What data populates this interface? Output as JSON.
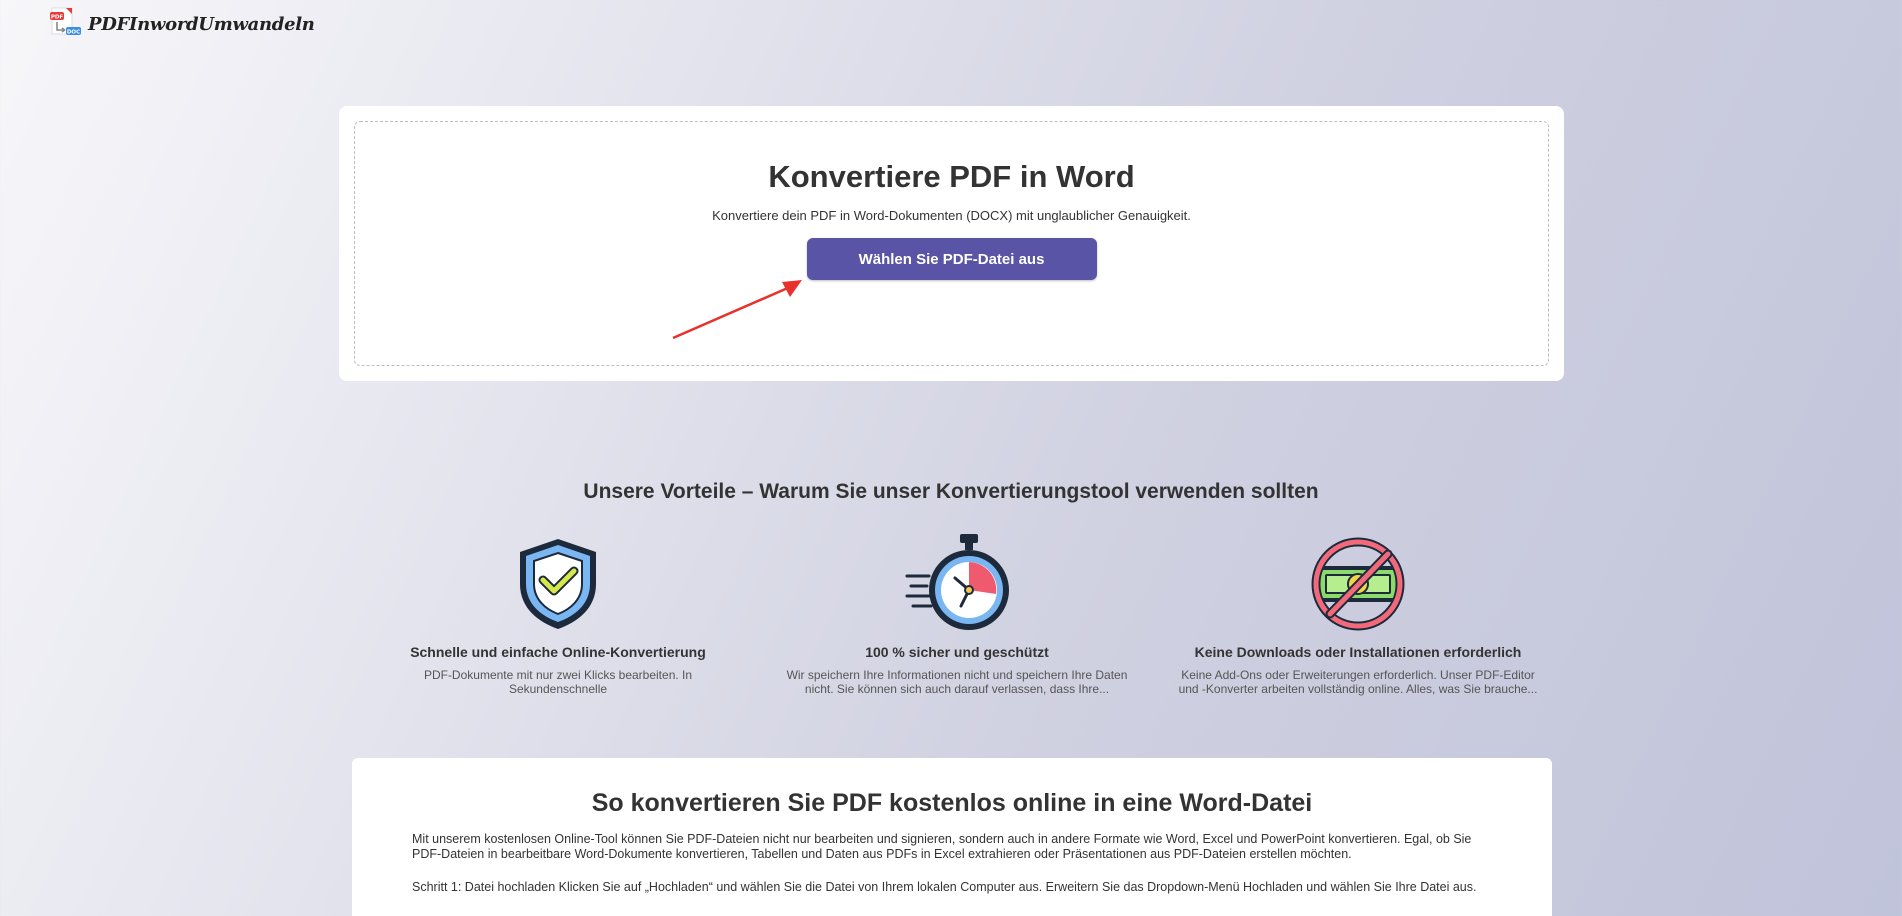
{
  "header": {
    "logo_text": "PDFInwordUmwandeln",
    "logo_badge_top": "PDF",
    "logo_badge_bottom": "DOC"
  },
  "upload": {
    "title": "Konvertiere PDF in Word",
    "subtitle": "Konvertiere dein PDF in Word-Dokumenten (DOCX) mit unglaublicher Genauigkeit.",
    "button_label": "Wählen Sie PDF-Datei aus"
  },
  "benefits": {
    "title": "Unsere Vorteile – Warum Sie unser Konvertierungstool verwenden sollten",
    "items": [
      {
        "icon": "shield-check-icon",
        "title": "Schnelle und einfache Online-Konvertierung",
        "text": "PDF-Dokumente mit nur zwei Klicks bearbeiten. In Sekundenschnelle"
      },
      {
        "icon": "stopwatch-icon",
        "title": "100 % sicher und geschützt",
        "text": "Wir speichern Ihre Informationen nicht und speichern Ihre Daten nicht. Sie können sich auch darauf verlassen, dass Ihre..."
      },
      {
        "icon": "no-money-icon",
        "title": "Keine Downloads oder Installationen erforderlich",
        "text": "Keine Add-Ons oder Erweiterungen erforderlich. Unser PDF-Editor und -Konverter arbeiten vollständig online. Alles, was Sie brauche..."
      }
    ]
  },
  "howto": {
    "title": "So konvertieren Sie PDF kostenlos online in eine Word-Datei",
    "intro": "Mit unserem kostenlosen Online-Tool können Sie PDF-Dateien nicht nur bearbeiten und signieren, sondern auch in andere Formate wie Word, Excel und PowerPoint konvertieren. Egal, ob Sie PDF-Dateien in bearbeitbare Word-Dokumente konvertieren, Tabellen und Daten aus PDFs in Excel extrahieren oder Präsentationen aus PDF-Dateien erstellen möchten.",
    "step1": "Schritt 1: Datei hochladen Klicken Sie auf „Hochladen“ und wählen Sie die Datei von Ihrem lokalen Computer aus. Erweitern Sie das Dropdown-Menü Hochladen und wählen Sie Ihre Datei aus."
  },
  "colors": {
    "button": "#5a54a6",
    "arrow": "#e8302c"
  }
}
